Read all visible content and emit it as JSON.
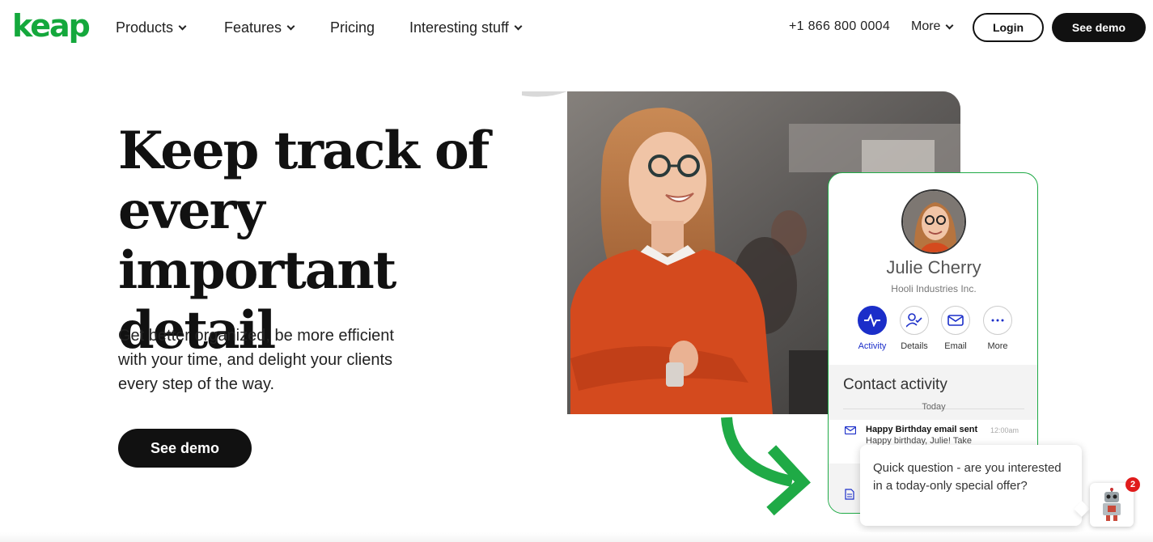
{
  "brand": {
    "logo_text": "keap",
    "accent_color": "#14a83c"
  },
  "nav": {
    "items": [
      {
        "label": "Products",
        "dropdown": true
      },
      {
        "label": "Features",
        "dropdown": true
      },
      {
        "label": "Pricing",
        "dropdown": false
      },
      {
        "label": "Interesting stuff",
        "dropdown": true
      }
    ],
    "phone": "+1 866 800 0004",
    "more_label": "More",
    "login_label": "Login",
    "demo_label": "See demo"
  },
  "hero": {
    "headline_lines": [
      "Keep track of",
      "every important",
      "detail"
    ],
    "subtext": "Get better organized, be more efficient with your time, and delight your clients every step of the way.",
    "cta_label": "See demo"
  },
  "contact_card": {
    "name": "Julie Cherry",
    "company": "Hooli Industries Inc.",
    "actions": [
      {
        "label": "Activity",
        "icon": "pulse-icon",
        "active": true
      },
      {
        "label": "Details",
        "icon": "person-check-icon",
        "active": false
      },
      {
        "label": "Email",
        "icon": "envelope-icon",
        "active": false
      },
      {
        "label": "More",
        "icon": "ellipsis-icon",
        "active": false
      }
    ],
    "activity_title": "Contact activity",
    "activity_group": "Today",
    "activity_item": {
      "title": "Happy Birthday email sent",
      "time": "12:00am",
      "body": "Happy birthday, Julie! Take"
    }
  },
  "chat": {
    "message": "Quick question - are you interested in a today-only special offer?",
    "badge_count": "2"
  }
}
